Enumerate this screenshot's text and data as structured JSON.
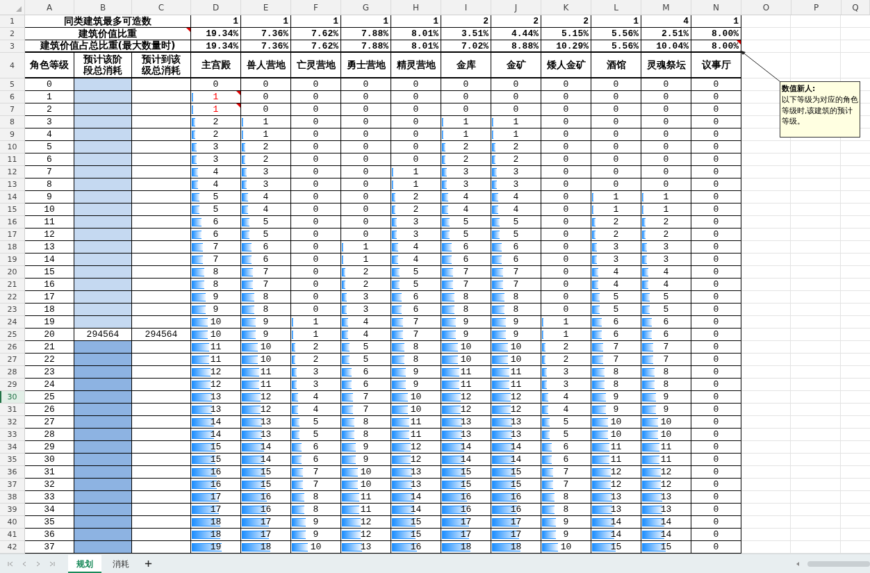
{
  "column_headers": [
    "A",
    "B",
    "C",
    "D",
    "E",
    "F",
    "G",
    "H",
    "I",
    "J",
    "K",
    "L",
    "M",
    "N",
    "O",
    "P",
    "Q"
  ],
  "summary_rows": [
    {
      "row_number": "1",
      "label": "同类建筑最多可造数",
      "noted": false,
      "values": [
        "1",
        "1",
        "1",
        "1",
        "1",
        "2",
        "2",
        "2",
        "1",
        "4",
        "1"
      ]
    },
    {
      "row_number": "2",
      "label": "建筑价值比重",
      "noted": true,
      "values": [
        "19.34%",
        "7.36%",
        "7.62%",
        "7.88%",
        "8.01%",
        "3.51%",
        "4.44%",
        "5.15%",
        "5.56%",
        "2.51%",
        "8.00%"
      ]
    },
    {
      "row_number": "3",
      "label": "建筑价值占总比重(最大数量时)",
      "noted": false,
      "values": [
        "19.34%",
        "7.36%",
        "7.62%",
        "7.88%",
        "8.01%",
        "7.02%",
        "8.88%",
        "10.29%",
        "5.56%",
        "10.04%",
        "8.00%"
      ]
    }
  ],
  "header_row": {
    "row_number": "4",
    "labels": [
      "角色等级",
      "预计该阶段总消耗",
      "预计到该级总消耗",
      "主宫殿",
      "兽人营地",
      "亡灵营地",
      "勇士营地",
      "精灵营地",
      "金库",
      "金矿",
      "矮人金矿",
      "酒馆",
      "灵魂祭坛",
      "议事厅"
    ]
  },
  "comment": {
    "author": "数值新人:",
    "text": "以下等级为对应的角色等级时,该建筑的预计等级。"
  },
  "rows": [
    {
      "row_number": "5",
      "level": "0",
      "color": "#c5d9f1",
      "noted": false,
      "selected": false,
      "values": [
        "0",
        "0",
        "0",
        "0",
        "0",
        "0",
        "0",
        "0",
        "0",
        "0",
        "0"
      ]
    },
    {
      "row_number": "6",
      "level": "1",
      "color": "#c5d9f1",
      "noted": true,
      "selected": false,
      "values": [
        "1",
        "0",
        "0",
        "0",
        "0",
        "0",
        "0",
        "0",
        "0",
        "0",
        "0"
      ]
    },
    {
      "row_number": "7",
      "level": "2",
      "color": "#c5d9f1",
      "noted": true,
      "selected": false,
      "values": [
        "1",
        "0",
        "0",
        "0",
        "0",
        "0",
        "0",
        "0",
        "0",
        "0",
        "0"
      ]
    },
    {
      "row_number": "8",
      "level": "3",
      "color": "#c5d9f1",
      "noted": false,
      "selected": false,
      "values": [
        "2",
        "1",
        "0",
        "0",
        "0",
        "1",
        "1",
        "0",
        "0",
        "0",
        "0"
      ]
    },
    {
      "row_number": "9",
      "level": "4",
      "color": "#c5d9f1",
      "noted": false,
      "selected": false,
      "values": [
        "2",
        "1",
        "0",
        "0",
        "0",
        "1",
        "1",
        "0",
        "0",
        "0",
        "0"
      ]
    },
    {
      "row_number": "10",
      "level": "5",
      "color": "#c5d9f1",
      "noted": false,
      "selected": false,
      "values": [
        "3",
        "2",
        "0",
        "0",
        "0",
        "2",
        "2",
        "0",
        "0",
        "0",
        "0"
      ]
    },
    {
      "row_number": "11",
      "level": "6",
      "color": "#c5d9f1",
      "noted": false,
      "selected": false,
      "values": [
        "3",
        "2",
        "0",
        "0",
        "0",
        "2",
        "2",
        "0",
        "0",
        "0",
        "0"
      ]
    },
    {
      "row_number": "12",
      "level": "7",
      "color": "#c5d9f1",
      "noted": false,
      "selected": false,
      "values": [
        "4",
        "3",
        "0",
        "0",
        "1",
        "3",
        "3",
        "0",
        "0",
        "0",
        "0"
      ]
    },
    {
      "row_number": "13",
      "level": "8",
      "color": "#c5d9f1",
      "noted": false,
      "selected": false,
      "values": [
        "4",
        "3",
        "0",
        "0",
        "1",
        "3",
        "3",
        "0",
        "0",
        "0",
        "0"
      ]
    },
    {
      "row_number": "14",
      "level": "9",
      "color": "#c5d9f1",
      "noted": false,
      "selected": false,
      "values": [
        "5",
        "4",
        "0",
        "0",
        "2",
        "4",
        "4",
        "0",
        "1",
        "1",
        "0"
      ]
    },
    {
      "row_number": "15",
      "level": "10",
      "color": "#c5d9f1",
      "noted": false,
      "selected": false,
      "values": [
        "5",
        "4",
        "0",
        "0",
        "2",
        "4",
        "4",
        "0",
        "1",
        "1",
        "0"
      ]
    },
    {
      "row_number": "16",
      "level": "11",
      "color": "#c5d9f1",
      "noted": false,
      "selected": false,
      "values": [
        "6",
        "5",
        "0",
        "0",
        "3",
        "5",
        "5",
        "0",
        "2",
        "2",
        "0"
      ]
    },
    {
      "row_number": "17",
      "level": "12",
      "color": "#c5d9f1",
      "noted": false,
      "selected": false,
      "values": [
        "6",
        "5",
        "0",
        "0",
        "3",
        "5",
        "5",
        "0",
        "2",
        "2",
        "0"
      ]
    },
    {
      "row_number": "18",
      "level": "13",
      "color": "#c5d9f1",
      "noted": false,
      "selected": false,
      "values": [
        "7",
        "6",
        "0",
        "1",
        "4",
        "6",
        "6",
        "0",
        "3",
        "3",
        "0"
      ]
    },
    {
      "row_number": "19",
      "level": "14",
      "color": "#c5d9f1",
      "noted": false,
      "selected": false,
      "values": [
        "7",
        "6",
        "0",
        "1",
        "4",
        "6",
        "6",
        "0",
        "3",
        "3",
        "0"
      ]
    },
    {
      "row_number": "20",
      "level": "15",
      "color": "#c5d9f1",
      "noted": false,
      "selected": false,
      "values": [
        "8",
        "7",
        "0",
        "2",
        "5",
        "7",
        "7",
        "0",
        "4",
        "4",
        "0"
      ]
    },
    {
      "row_number": "21",
      "level": "16",
      "color": "#c5d9f1",
      "noted": false,
      "selected": false,
      "values": [
        "8",
        "7",
        "0",
        "2",
        "5",
        "7",
        "7",
        "0",
        "4",
        "4",
        "0"
      ]
    },
    {
      "row_number": "22",
      "level": "17",
      "color": "#c5d9f1",
      "noted": false,
      "selected": false,
      "values": [
        "9",
        "8",
        "0",
        "3",
        "6",
        "8",
        "8",
        "0",
        "5",
        "5",
        "0"
      ]
    },
    {
      "row_number": "23",
      "level": "18",
      "color": "#c5d9f1",
      "noted": false,
      "selected": false,
      "values": [
        "9",
        "8",
        "0",
        "3",
        "6",
        "8",
        "8",
        "0",
        "5",
        "5",
        "0"
      ]
    },
    {
      "row_number": "24",
      "level": "19",
      "color": "#c5d9f1",
      "noted": false,
      "selected": false,
      "values": [
        "10",
        "9",
        "1",
        "4",
        "7",
        "9",
        "9",
        "1",
        "6",
        "6",
        "0"
      ]
    },
    {
      "row_number": "25",
      "level": "20",
      "stage_cost": "294564",
      "total_cost": "294564",
      "noted": false,
      "selected": false,
      "values": [
        "10",
        "9",
        "1",
        "4",
        "7",
        "9",
        "9",
        "1",
        "6",
        "6",
        "0"
      ]
    },
    {
      "row_number": "26",
      "level": "21",
      "color": "#8db3e2",
      "noted": false,
      "selected": false,
      "values": [
        "11",
        "10",
        "2",
        "5",
        "8",
        "10",
        "10",
        "2",
        "7",
        "7",
        "0"
      ]
    },
    {
      "row_number": "27",
      "level": "22",
      "color": "#8db3e2",
      "noted": false,
      "selected": false,
      "values": [
        "11",
        "10",
        "2",
        "5",
        "8",
        "10",
        "10",
        "2",
        "7",
        "7",
        "0"
      ]
    },
    {
      "row_number": "28",
      "level": "23",
      "color": "#8db3e2",
      "noted": false,
      "selected": false,
      "values": [
        "12",
        "11",
        "3",
        "6",
        "9",
        "11",
        "11",
        "3",
        "8",
        "8",
        "0"
      ]
    },
    {
      "row_number": "29",
      "level": "24",
      "color": "#8db3e2",
      "noted": false,
      "selected": false,
      "values": [
        "12",
        "11",
        "3",
        "6",
        "9",
        "11",
        "11",
        "3",
        "8",
        "8",
        "0"
      ]
    },
    {
      "row_number": "30",
      "level": "25",
      "color": "#8db3e2",
      "noted": false,
      "selected": true,
      "values": [
        "13",
        "12",
        "4",
        "7",
        "10",
        "12",
        "12",
        "4",
        "9",
        "9",
        "0"
      ]
    },
    {
      "row_number": "31",
      "level": "26",
      "color": "#8db3e2",
      "noted": false,
      "selected": false,
      "values": [
        "13",
        "12",
        "4",
        "7",
        "10",
        "12",
        "12",
        "4",
        "9",
        "9",
        "0"
      ]
    },
    {
      "row_number": "32",
      "level": "27",
      "color": "#8db3e2",
      "noted": false,
      "selected": false,
      "values": [
        "14",
        "13",
        "5",
        "8",
        "11",
        "13",
        "13",
        "5",
        "10",
        "10",
        "0"
      ]
    },
    {
      "row_number": "33",
      "level": "28",
      "color": "#8db3e2",
      "noted": false,
      "selected": false,
      "values": [
        "14",
        "13",
        "5",
        "8",
        "11",
        "13",
        "13",
        "5",
        "10",
        "10",
        "0"
      ]
    },
    {
      "row_number": "34",
      "level": "29",
      "color": "#8db3e2",
      "noted": false,
      "selected": false,
      "values": [
        "15",
        "14",
        "6",
        "9",
        "12",
        "14",
        "14",
        "6",
        "11",
        "11",
        "0"
      ]
    },
    {
      "row_number": "35",
      "level": "30",
      "color": "#8db3e2",
      "noted": false,
      "selected": false,
      "values": [
        "15",
        "14",
        "6",
        "9",
        "12",
        "14",
        "14",
        "6",
        "11",
        "11",
        "0"
      ]
    },
    {
      "row_number": "36",
      "level": "31",
      "color": "#8db3e2",
      "noted": false,
      "selected": false,
      "values": [
        "16",
        "15",
        "7",
        "10",
        "13",
        "15",
        "15",
        "7",
        "12",
        "12",
        "0"
      ]
    },
    {
      "row_number": "37",
      "level": "32",
      "color": "#8db3e2",
      "noted": false,
      "selected": false,
      "values": [
        "16",
        "15",
        "7",
        "10",
        "13",
        "15",
        "15",
        "7",
        "12",
        "12",
        "0"
      ]
    },
    {
      "row_number": "38",
      "level": "33",
      "color": "#8db3e2",
      "noted": false,
      "selected": false,
      "values": [
        "17",
        "16",
        "8",
        "11",
        "14",
        "16",
        "16",
        "8",
        "13",
        "13",
        "0"
      ]
    },
    {
      "row_number": "39",
      "level": "34",
      "color": "#8db3e2",
      "noted": false,
      "selected": false,
      "values": [
        "17",
        "16",
        "8",
        "11",
        "14",
        "16",
        "16",
        "8",
        "13",
        "13",
        "0"
      ]
    },
    {
      "row_number": "40",
      "level": "35",
      "color": "#8db3e2",
      "noted": false,
      "selected": false,
      "values": [
        "18",
        "17",
        "9",
        "12",
        "15",
        "17",
        "17",
        "9",
        "14",
        "14",
        "0"
      ]
    },
    {
      "row_number": "41",
      "level": "36",
      "color": "#8db3e2",
      "noted": false,
      "selected": false,
      "values": [
        "18",
        "17",
        "9",
        "12",
        "15",
        "17",
        "17",
        "9",
        "14",
        "14",
        "0"
      ]
    },
    {
      "row_number": "42",
      "level": "37",
      "color": "#8db3e2",
      "noted": false,
      "selected": false,
      "values": [
        "19",
        "18",
        "10",
        "13",
        "16",
        "18",
        "18",
        "10",
        "15",
        "15",
        "0"
      ]
    }
  ],
  "sheet_tabs": [
    {
      "label": "规划",
      "selected": true
    },
    {
      "label": "消耗",
      "selected": false
    }
  ]
}
